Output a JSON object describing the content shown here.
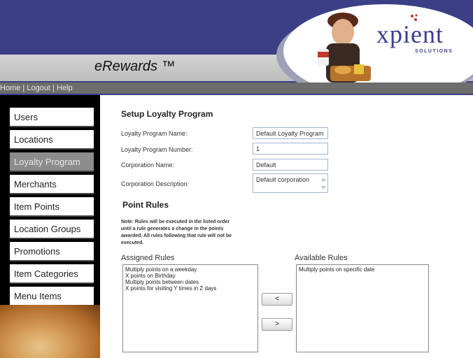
{
  "header": {
    "app_title": "eRewards ™",
    "logo_text": "xpient",
    "logo_subtext": "SOLUTIONS"
  },
  "topnav": {
    "home": "Home",
    "logout": "Logout",
    "help": "Help",
    "separator": " | "
  },
  "sidebar": {
    "items": [
      {
        "label": "Users"
      },
      {
        "label": "Locations"
      },
      {
        "label": "Loyalty Program",
        "active": true
      },
      {
        "label": "Merchants"
      },
      {
        "label": "Item Points"
      },
      {
        "label": "Location Groups"
      },
      {
        "label": "Promotions"
      },
      {
        "label": "Item Categories"
      },
      {
        "label": "Menu Items"
      }
    ]
  },
  "form": {
    "title": "Setup Loyalty Program",
    "fields": {
      "program_name": {
        "label": "Loyalty Program Name:",
        "value": "Default Loyalty Program"
      },
      "program_number": {
        "label": "Loyalty Program Number:",
        "value": "1"
      },
      "corporation_name": {
        "label": "Corporation Name:",
        "value": "Default"
      },
      "corporation_description": {
        "label": "Corporation Description:",
        "value": "Default corporation"
      }
    }
  },
  "point_rules": {
    "title": "Point Rules",
    "note_lines": [
      "Note: Rules will be executed in the listed order",
      "until a rule generates a change in the points",
      "awarded. All rules following that rule will not be",
      "executed."
    ],
    "assigned_label": "Assigned Rules",
    "available_label": "Available Rules",
    "assigned": [
      "Multiply points on a weekday",
      "X points on Birthday",
      "Multiply points between dates",
      "X points for visiting Y times in Z days"
    ],
    "available": [
      "Multiply points on specific date"
    ],
    "move_left_label": "<",
    "move_right_label": ">"
  },
  "colors": {
    "banner": "#3a3f86",
    "nav_active": "#8c8c8c",
    "field_border": "#9fb7cf"
  }
}
